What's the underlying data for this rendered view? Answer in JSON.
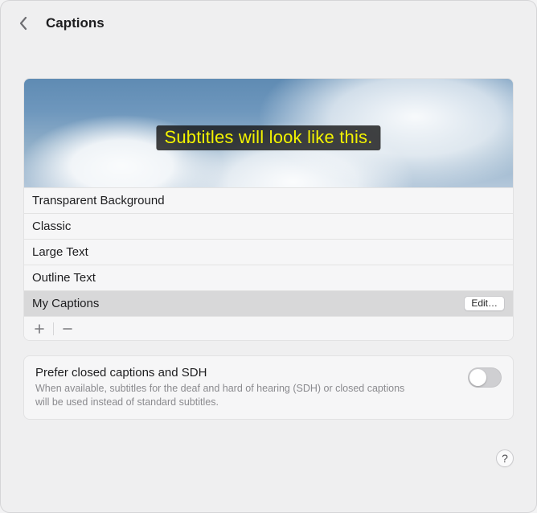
{
  "header": {
    "title": "Captions"
  },
  "preview": {
    "subtitle_text": "Subtitles will look like this.",
    "subtitle_color": "#f3f300",
    "pill_bg": "rgba(20,20,20,0.8)"
  },
  "styles": [
    {
      "label": "Transparent Background",
      "selected": false,
      "editable": false
    },
    {
      "label": "Classic",
      "selected": false,
      "editable": false
    },
    {
      "label": "Large Text",
      "selected": false,
      "editable": false
    },
    {
      "label": "Outline Text",
      "selected": false,
      "editable": false
    },
    {
      "label": "My Captions",
      "selected": true,
      "editable": true
    }
  ],
  "edit_button_label": "Edit…",
  "pref": {
    "title": "Prefer closed captions and SDH",
    "desc": "When available, subtitles for the deaf and hard of hearing (SDH) or closed captions will be used instead of standard subtitles.",
    "enabled": false
  },
  "help_label": "?"
}
